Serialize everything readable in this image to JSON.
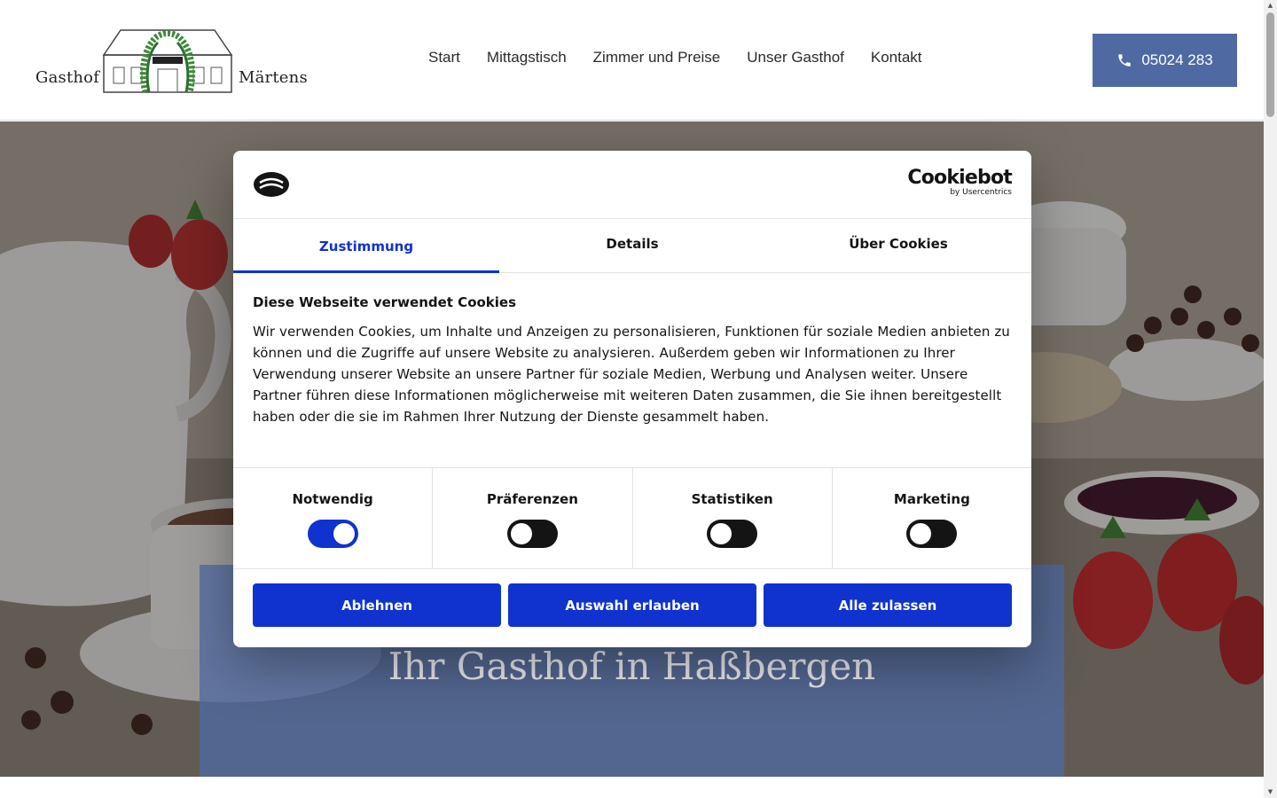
{
  "header": {
    "logo_left": "Gasthof",
    "logo_right": "Märtens",
    "nav": [
      "Start",
      "Mittagstisch",
      "Zimmer und Preise",
      "Unser Gasthof",
      "Kontakt"
    ],
    "phone": "05024 283"
  },
  "hero": {
    "title": "Ihr Gasthof in Haßbergen"
  },
  "cookie_dialog": {
    "brand_main": "Cookiebot",
    "brand_sub": "by Usercentrics",
    "tabs": [
      "Zustimmung",
      "Details",
      "Über Cookies"
    ],
    "active_tab": "Zustimmung",
    "body_title": "Diese Webseite verwendet Cookies",
    "body_text": "Wir verwenden Cookies, um Inhalte und Anzeigen zu personalisieren, Funktionen für soziale Medien anbieten zu können und die Zugriffe auf unsere Website zu analysieren. Außerdem geben wir Informationen zu Ihrer Verwendung unserer Website an unsere Partner für soziale Medien, Werbung und Analysen weiter. Unsere Partner führen diese Informationen möglicherweise mit weiteren Daten zusammen, die Sie ihnen bereitgestellt haben oder die sie im Rahmen Ihrer Nutzung der Dienste gesammelt haben.",
    "toggles": [
      {
        "label": "Notwendig",
        "on": true
      },
      {
        "label": "Präferenzen",
        "on": false
      },
      {
        "label": "Statistiken",
        "on": false
      },
      {
        "label": "Marketing",
        "on": false
      }
    ],
    "buttons": [
      "Ablehnen",
      "Auswahl erlauben",
      "Alle zulassen"
    ]
  },
  "colors": {
    "accent_blue": "#1032cf",
    "header_button": "#4f6aa3"
  }
}
